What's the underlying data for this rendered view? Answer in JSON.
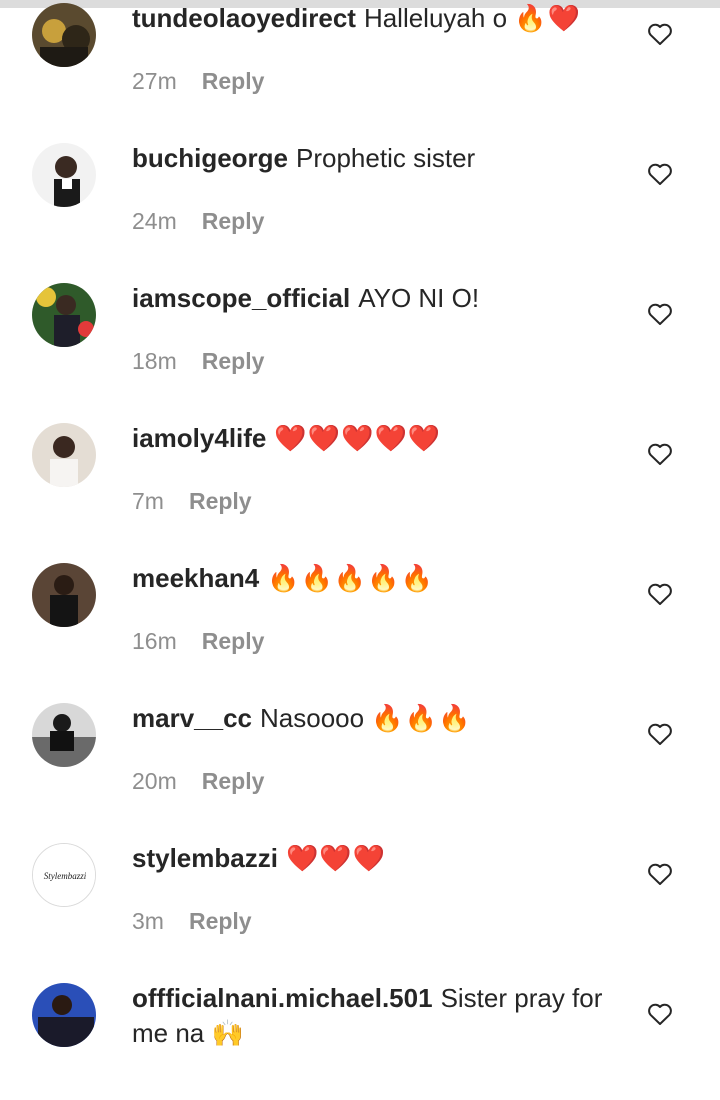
{
  "comments": [
    {
      "username": "tundeolaoyedirect",
      "text": "Halleluyah o",
      "emoji": "🔥❤️",
      "time": "27m",
      "reply": "Reply",
      "avatar_bg": "#5a4a2f"
    },
    {
      "username": "buchigeorge",
      "text": "Prophetic sister",
      "emoji": "",
      "time": "24m",
      "reply": "Reply",
      "avatar_bg": "#e8e8e8"
    },
    {
      "username": "iamscope_official",
      "text": "AYO NI O!",
      "emoji": "",
      "time": "18m",
      "reply": "Reply",
      "avatar_bg": "#3a6a2a"
    },
    {
      "username": "iamoly4life",
      "text": "",
      "emoji": "❤️❤️❤️❤️❤️",
      "time": "7m",
      "reply": "Reply",
      "avatar_bg": "#d8d0c8"
    },
    {
      "username": "meekhan4",
      "text": "",
      "emoji": "🔥🔥🔥🔥🔥",
      "time": "16m",
      "reply": "Reply",
      "avatar_bg": "#4a3a2c"
    },
    {
      "username": "marv__cc",
      "text": "Nasoooo",
      "emoji": "🔥🔥🔥",
      "time": "20m",
      "reply": "Reply",
      "avatar_bg": "#7a7a7a"
    },
    {
      "username": "stylembazzi",
      "text": "",
      "emoji": "❤️❤️❤️",
      "time": "3m",
      "reply": "Reply",
      "avatar_bg": "#ffffff",
      "avatar_text": "Stylembazzi"
    },
    {
      "username": "offficialnani.michael.501",
      "text": "Sister pray for me na",
      "emoji": "🙌",
      "time": "",
      "reply": "",
      "avatar_bg": "#2a4fb8"
    }
  ]
}
